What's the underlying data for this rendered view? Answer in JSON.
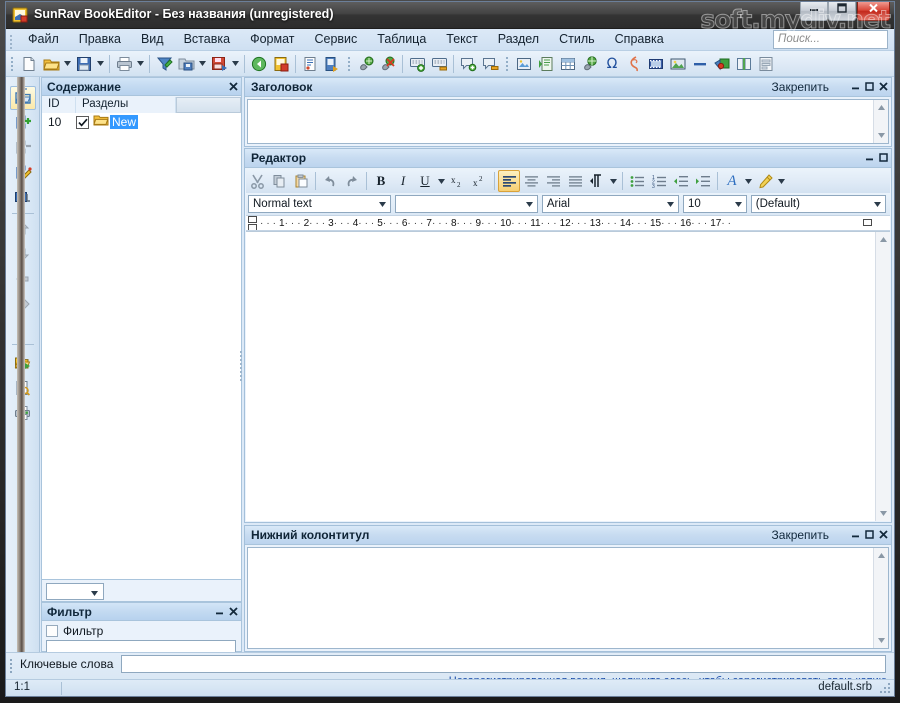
{
  "window": {
    "title": "SunRav BookEditor - Без названия (unregistered)",
    "icon": "book-editor-icon",
    "watermark": "soft.mydiv.net",
    "controls": [
      {
        "name": "minimize-button",
        "glyph": "minimize-icon"
      },
      {
        "name": "maximize-button",
        "glyph": "maximize-icon"
      },
      {
        "name": "close-button",
        "glyph": "close-icon"
      }
    ]
  },
  "menu": {
    "items": [
      {
        "label": "Файл"
      },
      {
        "label": "Правка"
      },
      {
        "label": "Вид"
      },
      {
        "label": "Вставка"
      },
      {
        "label": "Формат"
      },
      {
        "label": "Сервис"
      },
      {
        "label": "Таблица"
      },
      {
        "label": "Текст"
      },
      {
        "label": "Раздел"
      },
      {
        "label": "Стиль"
      },
      {
        "label": "Справка"
      }
    ]
  },
  "search": {
    "placeholder": "Поиск...",
    "value": ""
  },
  "toolbar": {
    "buttons": [
      {
        "name": "new-document-button",
        "icon": "new-document-icon",
        "tip": "Создать"
      },
      {
        "name": "open-button",
        "icon": "open-folder-icon",
        "tip": "Открыть"
      },
      {
        "name": "open-dropdown",
        "icon": "chevron-down-icon"
      },
      {
        "name": "save-button",
        "icon": "save-diskette-icon",
        "tip": "Сохранить"
      },
      {
        "name": "save-dropdown",
        "icon": "chevron-down-icon"
      },
      {
        "name": "print-button",
        "icon": "printer-icon",
        "tip": "Печать"
      },
      {
        "name": "print-dropdown",
        "icon": "chevron-down-icon"
      },
      {
        "name": "import-button",
        "icon": "import-funnel-icon",
        "tip": "Импорт"
      },
      {
        "name": "export-button",
        "icon": "export-disk-icon",
        "tip": "Экспорт"
      },
      {
        "name": "export-dropdown",
        "icon": "chevron-down-icon"
      },
      {
        "name": "save-as-button",
        "icon": "save-as-icon"
      },
      {
        "name": "save-as-dropdown",
        "icon": "chevron-down-icon"
      },
      {
        "name": "back-button",
        "icon": "back-arrow-icon"
      },
      {
        "name": "book-properties-button",
        "icon": "book-properties-icon"
      },
      {
        "name": "page-properties-button",
        "icon": "page-properties-icon"
      },
      {
        "name": "page-export-button",
        "icon": "page-export-icon"
      },
      {
        "name": "insert-hyperlink-button",
        "icon": "hyperlink-icon"
      },
      {
        "name": "remove-hyperlink-button",
        "icon": "remove-hyperlink-icon"
      },
      {
        "name": "insert-bookmark-button",
        "icon": "add-bookmark-icon"
      },
      {
        "name": "remove-bookmark-button",
        "icon": "remove-bookmark-icon"
      },
      {
        "name": "add-note-button",
        "icon": "add-note-icon"
      },
      {
        "name": "remove-note-button",
        "icon": "remove-note-icon"
      },
      {
        "name": "insert-picture-frame-button",
        "icon": "picture-frame-icon"
      },
      {
        "name": "insert-page-button",
        "icon": "insert-page-icon"
      },
      {
        "name": "insert-file-button",
        "icon": "insert-file-icon"
      },
      {
        "name": "insert-table-button",
        "icon": "table-grid-icon"
      },
      {
        "name": "insert-link-globe-button",
        "icon": "globe-link-icon"
      },
      {
        "name": "insert-symbol-button",
        "icon": "omega-symbol-icon"
      },
      {
        "name": "insert-flash-button",
        "icon": "flash-icon"
      },
      {
        "name": "insert-video-button",
        "icon": "film-strip-icon"
      },
      {
        "name": "insert-image-button",
        "icon": "image-icon"
      },
      {
        "name": "insert-hline-button",
        "icon": "horizontal-line-icon"
      },
      {
        "name": "insert-object-button",
        "icon": "object-3d-icon"
      },
      {
        "name": "insert-pagebreak-button",
        "icon": "page-break-icon"
      },
      {
        "name": "insert-form-button",
        "icon": "form-icon"
      }
    ]
  },
  "vstrip": {
    "buttons": [
      {
        "name": "contents-tree-button",
        "icon": "folder-icon",
        "active": true
      },
      {
        "name": "add-section-button",
        "icon": "add-node-icon"
      },
      {
        "name": "delete-section-button",
        "icon": "delete-node-icon"
      },
      {
        "name": "edit-section-button",
        "icon": "edit-node-icon"
      },
      {
        "name": "preview-section-button",
        "icon": "monitor-preview-icon"
      },
      {
        "name": "move-up-button",
        "icon": "arrow-up-icon"
      },
      {
        "name": "move-down-button",
        "icon": "arrow-down-icon"
      },
      {
        "name": "move-left-button",
        "icon": "arrow-left-icon"
      },
      {
        "name": "move-right-button",
        "icon": "arrow-right-icon"
      },
      {
        "name": "open-book-button",
        "icon": "open-book-folder-icon"
      },
      {
        "name": "preview-document-button",
        "icon": "document-search-icon"
      },
      {
        "name": "print-document-button",
        "icon": "printer-green-icon"
      }
    ]
  },
  "contents": {
    "title": "Содержание",
    "close_glyph": "close-icon",
    "columns": [
      "ID",
      "Разделы",
      ""
    ],
    "rows": [
      {
        "id": "10",
        "checked": true,
        "icon": "folder-icon",
        "label": "New",
        "selected": true
      }
    ],
    "combo_value": ""
  },
  "filter": {
    "title": "Фильтр",
    "checkbox_label": "Фильтр",
    "checked": false,
    "input_value": ""
  },
  "header_panel": {
    "title": "Заголовок",
    "pin_label": "Закрепить",
    "content": ""
  },
  "editor_panel": {
    "title": "Редактор",
    "content": "",
    "toolbar": [
      {
        "name": "cut-button",
        "icon": "scissors-icon"
      },
      {
        "name": "copy-button",
        "icon": "copy-icon"
      },
      {
        "name": "paste-button",
        "icon": "paste-icon"
      },
      {
        "name": "undo-button",
        "icon": "undo-icon"
      },
      {
        "name": "redo-button",
        "icon": "redo-icon"
      },
      {
        "name": "bold-button",
        "icon": "bold-icon",
        "label": "B"
      },
      {
        "name": "italic-button",
        "icon": "italic-icon",
        "label": "I"
      },
      {
        "name": "underline-button",
        "icon": "underline-icon",
        "label": "U"
      },
      {
        "name": "underline-dropdown",
        "icon": "chevron-down-icon"
      },
      {
        "name": "subscript-button",
        "icon": "subscript-icon"
      },
      {
        "name": "superscript-button",
        "icon": "superscript-icon"
      },
      {
        "name": "align-left-button",
        "icon": "align-left-icon",
        "active": true
      },
      {
        "name": "align-center-button",
        "icon": "align-center-icon"
      },
      {
        "name": "align-right-button",
        "icon": "align-right-icon"
      },
      {
        "name": "align-justify-button",
        "icon": "align-justify-icon"
      },
      {
        "name": "text-direction-button",
        "icon": "text-direction-icon"
      },
      {
        "name": "text-direction-dropdown",
        "icon": "chevron-down-icon"
      },
      {
        "name": "bullet-list-button",
        "icon": "bullet-list-icon"
      },
      {
        "name": "numbered-list-button",
        "icon": "numbered-list-icon"
      },
      {
        "name": "decrease-indent-button",
        "icon": "decrease-indent-icon"
      },
      {
        "name": "increase-indent-button",
        "icon": "increase-indent-icon"
      },
      {
        "name": "font-color-button",
        "icon": "font-color-icon",
        "label": "A"
      },
      {
        "name": "font-color-dropdown",
        "icon": "chevron-down-icon"
      },
      {
        "name": "highlight-button",
        "icon": "highlight-pen-icon"
      },
      {
        "name": "highlight-dropdown",
        "icon": "chevron-down-icon"
      }
    ],
    "combos": [
      {
        "name": "paragraph-style-combo",
        "value": "Normal text"
      },
      {
        "name": "character-style-combo",
        "value": ""
      },
      {
        "name": "font-family-combo",
        "value": "Arial"
      },
      {
        "name": "font-size-combo",
        "value": "10"
      },
      {
        "name": "language-combo",
        "value": "(Default)"
      }
    ],
    "ruler": {
      "ticks": [
        "1",
        "2",
        "3",
        "4",
        "5",
        "6",
        "7",
        "8",
        "9",
        "10",
        "11",
        "12",
        "13",
        "14",
        "15",
        "16",
        "17"
      ],
      "unit_separator": "·"
    }
  },
  "footer_panel": {
    "title": "Нижний колонтитул",
    "pin_label": "Закрепить",
    "content": ""
  },
  "keywords": {
    "label": "Ключевые слова",
    "value": ""
  },
  "registration": {
    "link_text": "Незарегистрированная версия. щелкните здесь, чтобы зарегистрировать свою копию."
  },
  "statusbar": {
    "position": "1:1",
    "filename": "default.srb"
  },
  "colors": {
    "accent": "#3399ff",
    "panel_caption": "#c8dcf1",
    "titlebar": "#343434",
    "close_button": "#c3291c",
    "link": "#1548a8",
    "workspace": "#dce9f7"
  }
}
